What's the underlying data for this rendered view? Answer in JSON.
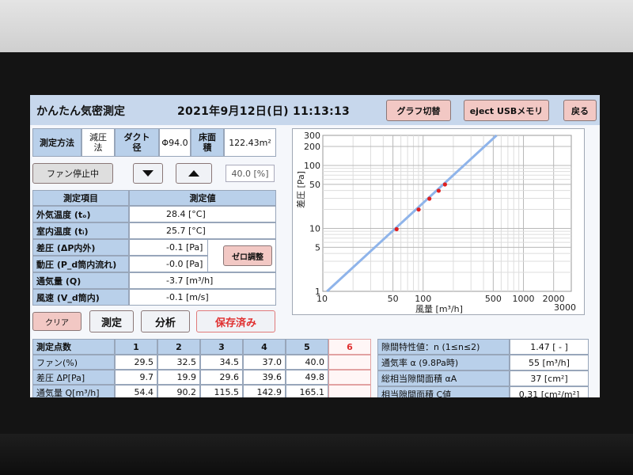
{
  "header": {
    "title": "かんたん気密測定",
    "datetime": "2021年9月12日(日) 11:13:13",
    "graph_toggle_label": "グラフ切替",
    "eject_usb_label": "eject USBメモリ",
    "back_label": "戻る"
  },
  "method_row": {
    "method_label": "測定方法",
    "method_value": "減圧法",
    "duct_label": "ダクト径",
    "duct_value": "Φ94.0",
    "floor_label": "床面積",
    "floor_value": "122.43m²"
  },
  "fan_controls": {
    "fan_stop_label": "ファン停止中",
    "fan_down_icon": "triangle-down",
    "fan_up_icon": "triangle-up",
    "fan_percent": "40.0 [%]"
  },
  "measurements": {
    "header_item": "測定項目",
    "header_value": "測定値",
    "rows": [
      {
        "label": "外気温度 (tₒ)",
        "value": "28.4 [°C]"
      },
      {
        "label": "室内温度 (tᵢ)",
        "value": "25.7 [°C]"
      },
      {
        "label": "差圧 (ΔP内外)",
        "value": "-0.1 [Pa]"
      },
      {
        "label": "動圧 (P_d筒内流れ)",
        "value": "-0.0 [Pa]"
      },
      {
        "label": "通気量 (Q)",
        "value": "-3.7 [m³/h]"
      },
      {
        "label": "風速 (V_d筒内)",
        "value": "-0.1 [m/s]"
      }
    ],
    "zero_adjust_label": "ゼロ調整"
  },
  "actions": {
    "clear_label": "クリア",
    "measure_label": "測定",
    "analyze_label": "分析",
    "saved_label": "保存済み"
  },
  "points_table": {
    "header_label": "測定点数",
    "columns": [
      "1",
      "2",
      "3",
      "4",
      "5",
      "6"
    ],
    "rows": [
      {
        "label": "ファン(%)",
        "values": [
          "29.5",
          "32.5",
          "34.5",
          "37.0",
          "40.0",
          ""
        ]
      },
      {
        "label": "差圧 ΔP[Pa]",
        "values": [
          "9.7",
          "19.9",
          "29.6",
          "39.6",
          "49.8",
          ""
        ]
      },
      {
        "label": "通気量 Q[m³/h]",
        "values": [
          "54.4",
          "90.2",
          "115.5",
          "142.9",
          "165.1",
          ""
        ]
      }
    ]
  },
  "results": [
    {
      "label": "隙間特性値：n (1≤n≤2)",
      "value": "1.47 [ - ]"
    },
    {
      "label": "通気率 α (9.8Pa時)",
      "value": "55 [m³/h]"
    },
    {
      "label": "総相当隙間面積 αA",
      "value": "37 [cm²]"
    },
    {
      "label": "相当隙間面積 C値",
      "value": "0.31 [cm²/m²]"
    }
  ],
  "chart_data": {
    "type": "scatter",
    "x_scale": "log",
    "y_scale": "log",
    "xlabel": "風量 [m³/h]",
    "ylabel": "差圧 [Pa]",
    "xlim": [
      10,
      3000
    ],
    "ylim": [
      1,
      300
    ],
    "x_ticks": [
      10,
      50,
      100,
      500,
      1000,
      2000,
      3000
    ],
    "y_ticks": [
      1,
      5,
      10,
      50,
      100,
      200,
      300
    ],
    "grid": true,
    "point_color": "#e02020",
    "line_color": "#8fb4ea",
    "points": [
      {
        "x": 54.4,
        "y": 9.7
      },
      {
        "x": 90.2,
        "y": 19.9
      },
      {
        "x": 115.5,
        "y": 29.6
      },
      {
        "x": 142.9,
        "y": 39.6
      },
      {
        "x": 165.1,
        "y": 49.8
      }
    ],
    "fit_line": [
      {
        "x": 11,
        "y": 1
      },
      {
        "x": 540,
        "y": 300
      }
    ]
  }
}
